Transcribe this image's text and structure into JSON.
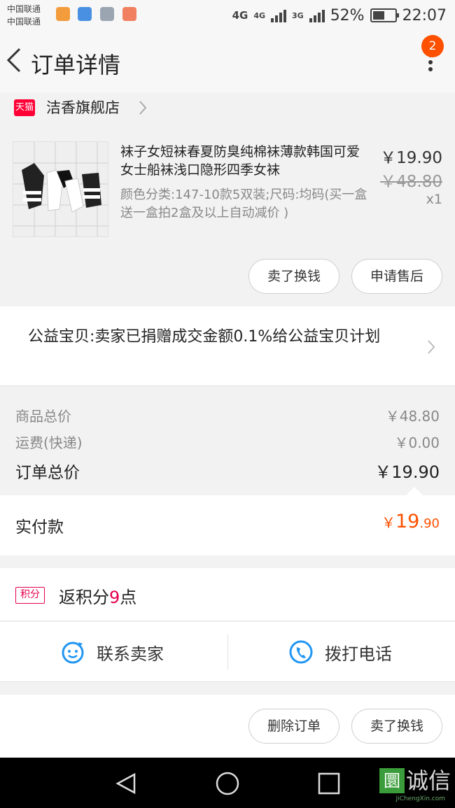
{
  "status_bar": {
    "carrier_1": "中国联通",
    "carrier_2": "中国联通",
    "network_1": "4G",
    "network_2": "4G",
    "network_3": "3G",
    "battery": "52%",
    "time": "22:07"
  },
  "header": {
    "title": "订单详情",
    "notification_count": "2"
  },
  "shop": {
    "badge": "天猫",
    "name": "洁香旗舰店"
  },
  "product": {
    "title": "袜子女短袜春夏防臭纯棉袜薄款韩国可爱女士船袜浅口隐形四季女袜",
    "spec": "颜色分类:147-10款5双装;尺码:均码(买一盒送一盒拍2盒及以上自动减价 )",
    "price": "￥19.90",
    "original_price": "￥48.80",
    "quantity": "x1",
    "sell_button": "卖了换钱",
    "aftersale_button": "申请售后"
  },
  "charity": {
    "text": "公益宝贝:卖家已捐赠成交金额0.1%给公益宝贝计划"
  },
  "summary": {
    "goods_label": "商品总价",
    "goods_value": "￥48.80",
    "shipping_label": "运费(快递)",
    "shipping_value": "￥0.00",
    "order_total_label": "订单总价",
    "order_total_value": "￥19.90",
    "paid_label": "实付款",
    "paid_yen": "￥",
    "paid_int": "19",
    "paid_dec": ".90"
  },
  "points": {
    "tag": "积分",
    "prefix": "返积分",
    "number": "9",
    "suffix": "点"
  },
  "contact": {
    "seller_label": "联系卖家",
    "phone_label": "拨打电话"
  },
  "footer": {
    "delete_button": "删除订单",
    "sell_button": "卖了换钱"
  },
  "watermark": {
    "logo": "圜",
    "text": "诚信",
    "url": "JiChengXin.com"
  },
  "colors": {
    "accent": "#ff5000",
    "tmall_red": "#ff0036",
    "points_red": "#e5004f",
    "icon_blue": "#2196f3"
  }
}
